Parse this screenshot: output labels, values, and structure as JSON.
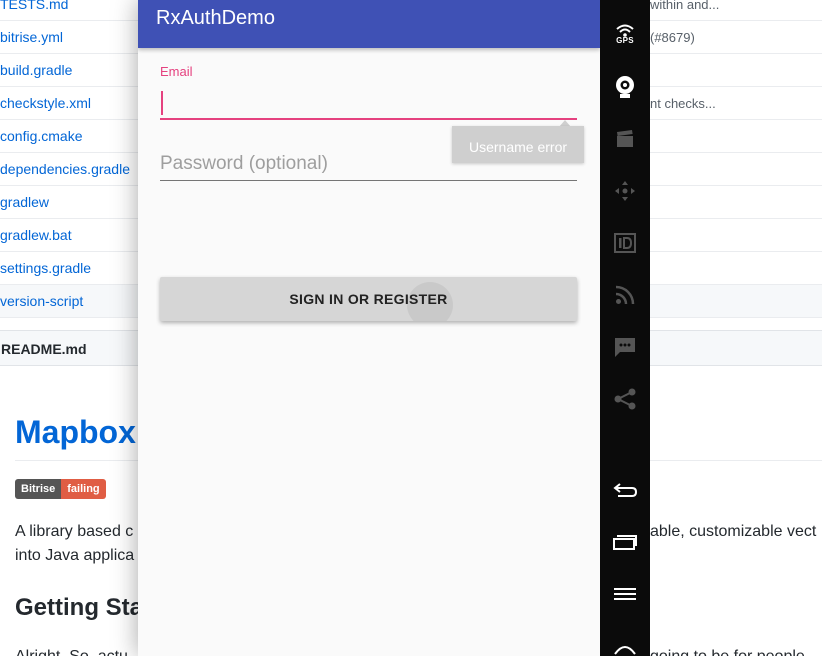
{
  "background_page": {
    "files": [
      {
        "name": "TESTS.md",
        "message": "within and..."
      },
      {
        "name": "bitrise.yml",
        "message": "(#8679)"
      },
      {
        "name": "build.gradle",
        "message": ""
      },
      {
        "name": "checkstyle.xml",
        "message": "nt checks..."
      },
      {
        "name": "config.cmake",
        "message": ""
      },
      {
        "name": "dependencies.gradle",
        "message": ""
      },
      {
        "name": "gradlew",
        "message": ""
      },
      {
        "name": "gradlew.bat",
        "message": ""
      },
      {
        "name": "settings.gradle",
        "message": ""
      },
      {
        "name": "version-script",
        "message": ""
      }
    ],
    "readme": {
      "header": "README.md",
      "title": "Mapbox",
      "badge_left": "Bitrise",
      "badge_right": "failing",
      "para_line1_left": "A library based c",
      "para_line1_right": "able, customizable vect",
      "para_line2_left": "into Java applica",
      "section_title": "Getting Sta",
      "para2_left": "Alright. So, actu",
      "para2_right": "going to be for people"
    }
  },
  "app": {
    "title": "RxAuthDemo",
    "email_label": "Email",
    "email_value": "",
    "email_error": "Username error",
    "password_placeholder": "Password (optional)",
    "password_value": "",
    "signin_label": "SIGN IN OR REGISTER"
  },
  "toolbar": {
    "gps_label": "GPS",
    "icons": [
      "gps-icon",
      "camera-icon",
      "clapperboard-icon",
      "dpad-icon",
      "id-icon",
      "cast-icon",
      "sms-icon",
      "share-icon",
      "back-icon",
      "recents-icon",
      "menu-icon",
      "home-icon"
    ]
  },
  "colors": {
    "app_bar": "#3f51b5",
    "accent": "#e5417f",
    "link": "#0366d6",
    "toolbar_bg": "#0b0b0b"
  }
}
